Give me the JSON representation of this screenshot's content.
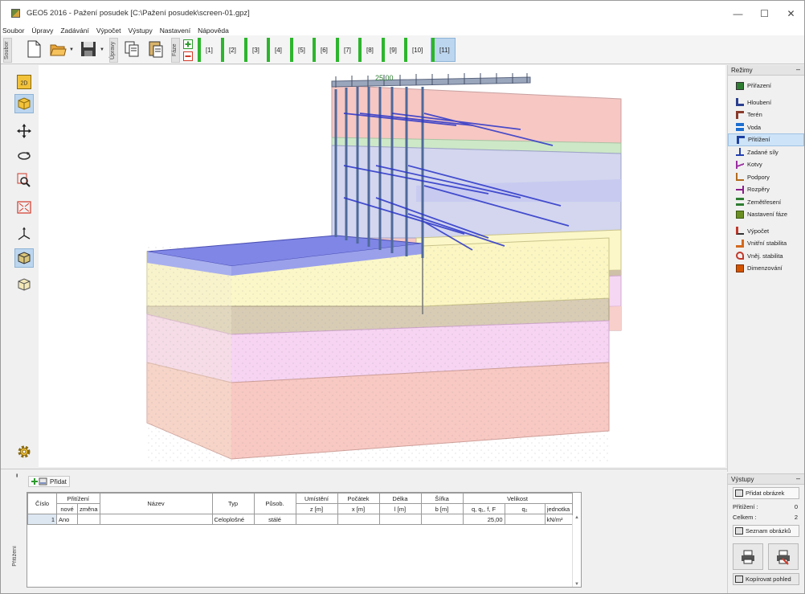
{
  "window": {
    "title": "GEO5 2016 - Pažení posudek [C:\\Pažení posudek\\screen-01.gpz]",
    "minimize": "—",
    "maximize": "☐",
    "close": "✕"
  },
  "menu": [
    "Soubor",
    "Úpravy",
    "Zadávání",
    "Výpočet",
    "Výstupy",
    "Nastavení",
    "Nápověda"
  ],
  "toolbar": {
    "file_label": "Soubor",
    "edit_label": "Úpravy",
    "phase_label": "Fáze",
    "phases": [
      "[1]",
      "[2]",
      "[3]",
      "[4]",
      "[5]",
      "[6]",
      "[7]",
      "[8]",
      "[9]",
      "[10]",
      "[11]"
    ],
    "active_phase": "[11]"
  },
  "viewport": {
    "load_label": "25,00"
  },
  "modes": {
    "header": "Režimy",
    "collapse": "–",
    "items": [
      {
        "label": "Přiřazení",
        "icon": "assign-icon",
        "color": "#2e7d32"
      },
      {
        "label": "Hloubení",
        "icon": "excavation-icon",
        "color": "#2b3f8f"
      },
      {
        "label": "Terén",
        "icon": "terrain-icon",
        "color": "#8a3a2a"
      },
      {
        "label": "Voda",
        "icon": "water-icon",
        "color": "#1e6fd0"
      },
      {
        "label": "Přitížení",
        "icon": "surcharge-icon",
        "color": "#1d3fa0"
      },
      {
        "label": "Zadané síly",
        "icon": "forces-icon",
        "color": "#2340b0"
      },
      {
        "label": "Kotvy",
        "icon": "anchors-icon",
        "color": "#9a2ea0"
      },
      {
        "label": "Podpory",
        "icon": "supports-icon",
        "color": "#b26a1c"
      },
      {
        "label": "Rozpěry",
        "icon": "struts-icon",
        "color": "#8a1e8a"
      },
      {
        "label": "Zemětřesení",
        "icon": "earthquake-icon",
        "color": "#2e7d32"
      },
      {
        "label": "Nastavení fáze",
        "icon": "phase-settings-icon",
        "color": "#6b8e23"
      },
      {
        "label": "Výpočet",
        "icon": "calculation-icon",
        "color": "#c0392b"
      },
      {
        "label": "Vnitřní stabilita",
        "icon": "internal-stability-icon",
        "color": "#d2691e"
      },
      {
        "label": "Vněj. stabilita",
        "icon": "external-stability-icon",
        "color": "#c0392b"
      },
      {
        "label": "Dimenzování",
        "icon": "dimensioning-icon",
        "color": "#d35400"
      }
    ],
    "selected": "Přitížení"
  },
  "bottom": {
    "side_label": "Přitížení",
    "add_label": "Přidat",
    "headers": {
      "cislo": "Číslo",
      "pritizeni": "Přitížení",
      "nove": "nové",
      "zmena": "změna",
      "nazev": "Název",
      "typ": "Typ",
      "pusob": "Působ.",
      "umisteni": "Umístění",
      "umisteni_unit": "z [m]",
      "pocatek": "Počátek",
      "pocatek_unit": "x [m]",
      "delka": "Délka",
      "delka_unit": "l [m]",
      "sirka": "Šířka",
      "sirka_unit": "b [m]",
      "velikost": "Velikost",
      "q_main": "q, q₁, f, F",
      "q2": "q₂",
      "jednotka": "jednotka"
    },
    "rows": [
      {
        "cislo": "1",
        "nove": "Ano",
        "zmena": "",
        "nazev": "",
        "typ": "Celoplošné",
        "pusob": "stálé",
        "umisteni": "",
        "pocatek": "",
        "delka": "",
        "sirka": "",
        "q1": "25,00",
        "q2": "",
        "jednotka": "kN/m²"
      }
    ]
  },
  "outputs": {
    "header": "Výstupy",
    "collapse": "–",
    "add_picture": "Přidat obrázek",
    "surcharge_label": "Přitížení :",
    "surcharge_count": "0",
    "total_label": "Celkem :",
    "total_count": "2",
    "list_pictures": "Seznam obrázků",
    "copy_view": "Kopírovat pohled"
  }
}
